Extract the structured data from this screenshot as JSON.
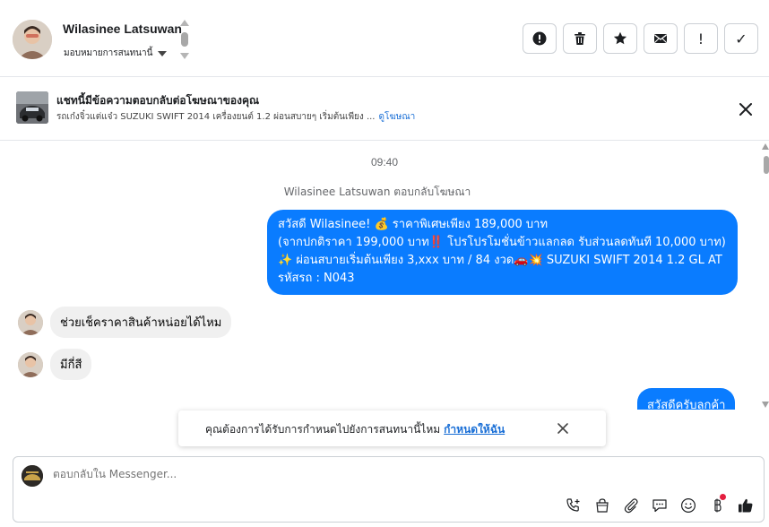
{
  "header": {
    "contact_name": "Wilasinee Latsuwan",
    "assign_label": "มอบหมายการสนทนานี้",
    "actions": {
      "spam": "!",
      "done": "✓"
    }
  },
  "ad_banner": {
    "title": "แชทนี้มีข้อความตอบกลับต่อโฆษณาของคุณ",
    "subtitle": "รถเก๋งจิ๋วแต่แจ๋ว SUZUKI SWIFT 2014 เครื่องยนต์ 1.2 ผ่อนสบายๆ เริ่มต้นเพียง ...",
    "link_label": "ดูโฆษณา"
  },
  "chat": {
    "timestamp": "09:40",
    "system_note": "Wilasinee Latsuwan ตอบกลับโฆษณา",
    "outgoing_lines": [
      "สวัสดี Wilasinee! 💰 ราคาพิเศษเพียง 189,000 บาท",
      "(จากปกติราคา 199,000 บาท‼️ โปรโปรโมชั่นข้าวแลกลด รับส่วนลดทันที 10,000 บาท)",
      "✨ ผ่อนสบายเริ่มต้นเพียง 3,xxx บาท / 84 งวด🚗💥 SUZUKI SWIFT 2014 1.2 GL AT",
      "รหัสรถ : N043"
    ],
    "incoming": [
      "ช่วยเช็คราคาสินค้าหน่อยได้ไหม",
      "มีกี่สี"
    ],
    "outgoing_2": "สวัสดีครับลูกค้า"
  },
  "toast": {
    "text": "คุณต้องการได้รับการกำหนดไปยังการสนทนานี้ไหม",
    "link": "กำหนดให้ฉัน"
  },
  "composer": {
    "placeholder": "ตอบกลับใน Messenger...",
    "tools": [
      "phone-plus-icon",
      "shopping-bag-icon",
      "paperclip-icon",
      "chat-reply-icon",
      "emoji-icon",
      "baht-icon",
      "thumbs-up-icon"
    ]
  },
  "colors": {
    "accent": "#0a7cff",
    "link": "#1a6fd6",
    "notification_dot": "#e41e3f"
  }
}
